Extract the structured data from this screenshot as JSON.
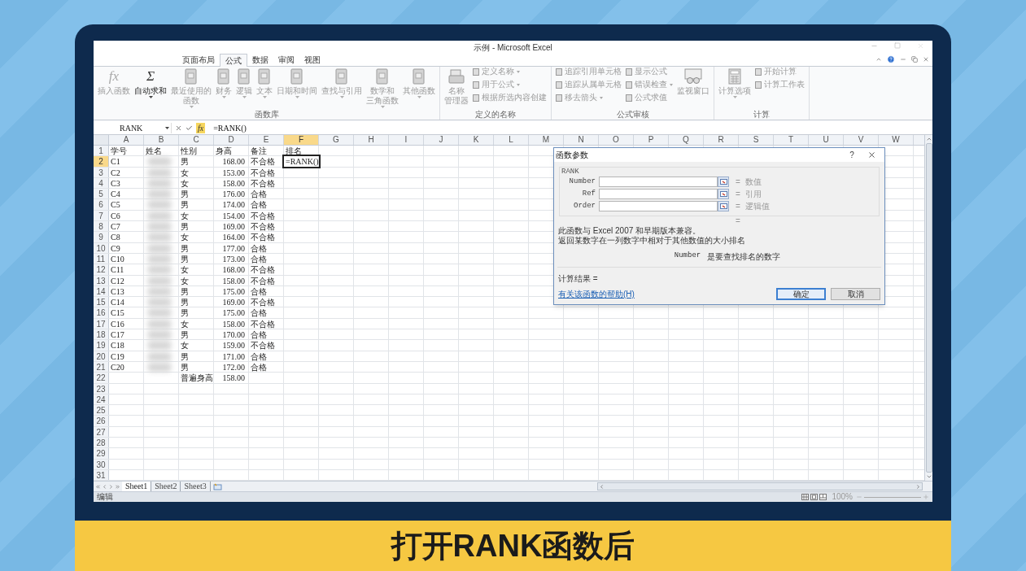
{
  "window": {
    "title": "示例 - Microsoft Excel"
  },
  "ribbon_tabs": [
    {
      "label": "页面布局",
      "selected": false
    },
    {
      "label": "公式",
      "selected": true
    },
    {
      "label": "数据",
      "selected": false
    },
    {
      "label": "审阅",
      "selected": false
    },
    {
      "label": "视图",
      "selected": false
    }
  ],
  "ribbon_groups": [
    {
      "label": "函数库",
      "items": [
        {
          "kind": "large",
          "glyph": "fx",
          "lines": [
            "插入函数"
          ],
          "dropdown": false,
          "disabled": true
        },
        {
          "kind": "large",
          "glyph": "Σ",
          "lines": [
            "自动求和"
          ],
          "dropdown": true,
          "disabled": false
        },
        {
          "kind": "large",
          "lines": [
            "最近使用的",
            "函数"
          ],
          "dropdown": true,
          "disabled": true
        },
        {
          "kind": "large",
          "lines": [
            "财务"
          ],
          "dropdown": true,
          "disabled": true
        },
        {
          "kind": "large",
          "lines": [
            "逻辑"
          ],
          "dropdown": true,
          "disabled": true
        },
        {
          "kind": "large",
          "lines": [
            "文本"
          ],
          "dropdown": true,
          "disabled": true
        },
        {
          "kind": "large",
          "lines": [
            "日期和时间"
          ],
          "dropdown": true,
          "disabled": true
        },
        {
          "kind": "large",
          "lines": [
            "查找与引用"
          ],
          "dropdown": true,
          "disabled": true
        },
        {
          "kind": "large",
          "lines": [
            "数学和",
            "三角函数"
          ],
          "dropdown": true,
          "disabled": true
        },
        {
          "kind": "large",
          "lines": [
            "其他函数"
          ],
          "dropdown": true,
          "disabled": true
        }
      ]
    },
    {
      "label": "定义的名称",
      "items": [
        {
          "kind": "large",
          "lines": [
            "名称",
            "管理器"
          ],
          "dropdown": false,
          "disabled": true
        },
        {
          "kind": "stack",
          "items": [
            {
              "label": "定义名称",
              "dropdown": true,
              "disabled": true
            },
            {
              "label": "用于公式",
              "dropdown": true,
              "disabled": true
            },
            {
              "label": "根据所选内容创建",
              "dropdown": false,
              "disabled": true
            }
          ]
        }
      ]
    },
    {
      "label": "公式审核",
      "items": [
        {
          "kind": "stack",
          "items": [
            {
              "label": "追踪引用单元格",
              "dropdown": false,
              "disabled": true
            },
            {
              "label": "追踪从属单元格",
              "dropdown": false,
              "disabled": true
            },
            {
              "label": "移去箭头",
              "dropdown": true,
              "disabled": true
            }
          ]
        },
        {
          "kind": "stack",
          "items": [
            {
              "label": "显示公式",
              "dropdown": false,
              "disabled": true
            },
            {
              "label": "错误检查",
              "dropdown": true,
              "disabled": true
            },
            {
              "label": "公式求值",
              "dropdown": false,
              "disabled": true
            }
          ]
        },
        {
          "kind": "large",
          "lines": [
            "监视窗口"
          ],
          "dropdown": false,
          "disabled": true
        }
      ]
    },
    {
      "label": "计算",
      "items": [
        {
          "kind": "large",
          "lines": [
            "计算选项"
          ],
          "dropdown": true,
          "disabled": true
        },
        {
          "kind": "stack",
          "items": [
            {
              "label": "开始计算",
              "dropdown": false,
              "disabled": true
            },
            {
              "label": "计算工作表",
              "dropdown": false,
              "disabled": true
            }
          ]
        }
      ]
    }
  ],
  "formula_bar": {
    "name_box": "RANK",
    "fx": "fx",
    "formula": "=RANK()"
  },
  "sheet": {
    "columns": [
      {
        "label": "A",
        "selected": false
      },
      {
        "label": "B",
        "selected": false
      },
      {
        "label": "C",
        "selected": false
      },
      {
        "label": "D",
        "selected": false
      },
      {
        "label": "E",
        "selected": false
      },
      {
        "label": "F",
        "selected": true
      },
      {
        "label": "G",
        "selected": false
      },
      {
        "label": "H",
        "selected": false
      },
      {
        "label": "I",
        "selected": false
      },
      {
        "label": "J",
        "selected": false
      },
      {
        "label": "K",
        "selected": false
      },
      {
        "label": "L",
        "selected": false
      },
      {
        "label": "M",
        "selected": false
      },
      {
        "label": "N",
        "selected": false
      },
      {
        "label": "O",
        "selected": false
      },
      {
        "label": "P",
        "selected": false
      },
      {
        "label": "Q",
        "selected": false
      },
      {
        "label": "R",
        "selected": false
      },
      {
        "label": "S",
        "selected": false
      },
      {
        "label": "T",
        "selected": false
      },
      {
        "label": "U",
        "selected": false
      },
      {
        "label": "V",
        "selected": false
      },
      {
        "label": "W",
        "selected": false
      }
    ],
    "rows": [
      {
        "label": "1",
        "selected": false,
        "cells": [
          "学号",
          "姓名",
          "性别",
          "身高",
          "备注",
          "排名"
        ]
      },
      {
        "label": "2",
        "selected": true,
        "cells": [
          "C1",
          "",
          "男",
          "168.00",
          "不合格",
          "=RANK()"
        ]
      },
      {
        "label": "3",
        "selected": false,
        "cells": [
          "C2",
          "",
          "女",
          "153.00",
          "不合格"
        ]
      },
      {
        "label": "4",
        "selected": false,
        "cells": [
          "C3",
          "",
          "女",
          "158.00",
          "不合格"
        ]
      },
      {
        "label": "5",
        "selected": false,
        "cells": [
          "C4",
          "",
          "男",
          "176.00",
          "合格"
        ]
      },
      {
        "label": "6",
        "selected": false,
        "cells": [
          "C5",
          "",
          "男",
          "174.00",
          "合格"
        ]
      },
      {
        "label": "7",
        "selected": false,
        "cells": [
          "C6",
          "",
          "女",
          "154.00",
          "不合格"
        ]
      },
      {
        "label": "8",
        "selected": false,
        "cells": [
          "C7",
          "",
          "男",
          "169.00",
          "不合格"
        ]
      },
      {
        "label": "9",
        "selected": false,
        "cells": [
          "C8",
          "",
          "女",
          "164.00",
          "不合格"
        ]
      },
      {
        "label": "10",
        "selected": false,
        "cells": [
          "C9",
          "",
          "男",
          "177.00",
          "合格"
        ]
      },
      {
        "label": "11",
        "selected": false,
        "cells": [
          "C10",
          "",
          "男",
          "173.00",
          "合格"
        ]
      },
      {
        "label": "12",
        "selected": false,
        "cells": [
          "C11",
          "",
          "女",
          "168.00",
          "不合格"
        ]
      },
      {
        "label": "13",
        "selected": false,
        "cells": [
          "C12",
          "",
          "女",
          "158.00",
          "不合格"
        ]
      },
      {
        "label": "14",
        "selected": false,
        "cells": [
          "C13",
          "",
          "男",
          "175.00",
          "合格"
        ]
      },
      {
        "label": "15",
        "selected": false,
        "cells": [
          "C14",
          "",
          "男",
          "169.00",
          "不合格"
        ]
      },
      {
        "label": "16",
        "selected": false,
        "cells": [
          "C15",
          "",
          "男",
          "175.00",
          "合格"
        ]
      },
      {
        "label": "17",
        "selected": false,
        "cells": [
          "C16",
          "",
          "女",
          "158.00",
          "不合格"
        ]
      },
      {
        "label": "18",
        "selected": false,
        "cells": [
          "C17",
          "",
          "男",
          "170.00",
          "合格"
        ]
      },
      {
        "label": "19",
        "selected": false,
        "cells": [
          "C18",
          "",
          "女",
          "159.00",
          "不合格"
        ]
      },
      {
        "label": "20",
        "selected": false,
        "cells": [
          "C19",
          "",
          "男",
          "171.00",
          "合格"
        ]
      },
      {
        "label": "21",
        "selected": false,
        "cells": [
          "C20",
          "",
          "男",
          "172.00",
          "合格"
        ]
      },
      {
        "label": "22",
        "selected": false,
        "cells": [
          "",
          "",
          "普遍身高",
          "158.00"
        ]
      },
      {
        "label": "23",
        "selected": false,
        "cells": []
      },
      {
        "label": "24",
        "selected": false,
        "cells": []
      },
      {
        "label": "25",
        "selected": false,
        "cells": []
      },
      {
        "label": "26",
        "selected": false,
        "cells": []
      },
      {
        "label": "27",
        "selected": false,
        "cells": []
      },
      {
        "label": "28",
        "selected": false,
        "cells": []
      },
      {
        "label": "29",
        "selected": false,
        "cells": []
      },
      {
        "label": "30",
        "selected": false,
        "cells": []
      },
      {
        "label": "31",
        "selected": false,
        "cells": []
      }
    ],
    "tabs": [
      {
        "label": "Sheet1",
        "selected": true
      },
      {
        "label": "Sheet2",
        "selected": false
      },
      {
        "label": "Sheet3",
        "selected": false
      }
    ]
  },
  "status_bar": {
    "mode": "编辑",
    "zoom": "100%"
  },
  "dialog": {
    "title": "函数参数",
    "help": "?",
    "function": "RANK",
    "args": [
      {
        "label": "Number",
        "hint": "数值"
      },
      {
        "label": "Ref",
        "hint": "引用"
      },
      {
        "label": "Order",
        "hint": "逻辑值"
      }
    ],
    "equals": "=",
    "description": [
      "此函数与 Excel 2007 和早期版本兼容。",
      "返回某数字在一列数字中相对于其他数值的大小排名"
    ],
    "arg_help": {
      "name": "Number",
      "text": "是要查找排名的数字"
    },
    "result": "计算结果 =",
    "help_link": "有关该函数的帮助(H)",
    "buttons": [
      {
        "label": "确定",
        "default": true
      },
      {
        "label": "取消",
        "default": false
      }
    ]
  },
  "caption": "打开RANK函数后"
}
